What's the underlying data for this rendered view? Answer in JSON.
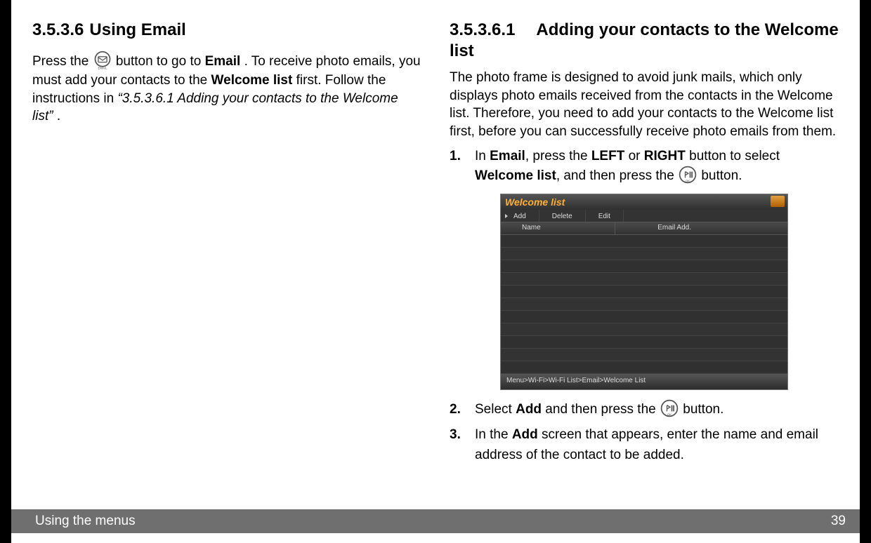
{
  "left": {
    "heading_num": "3.5.3.6",
    "heading_title": "Using Email",
    "p1_pre": "Press the ",
    "p1_mid1": " button to go to ",
    "p1_email": "Email",
    "p1_mid2": ". To receive photo emails, you must add your contacts to the ",
    "p1_welcome": "Welcome list",
    "p1_mid3": " first. Follow the instructions in ",
    "p1_ref": "“3.5.3.6.1 Adding your contacts to the Welcome list”",
    "p1_end": "."
  },
  "right": {
    "heading_num": "3.5.3.6.1",
    "heading_title": "Adding your contacts to the Welcome list",
    "intro": "The photo frame is designed to avoid junk mails, which only displays photo emails received from the contacts in the Welcome list. Therefore, you need to add your contacts to the Welcome list first, before you can successfully receive photo emails from them.",
    "steps": {
      "s1": {
        "marker": "1.",
        "t1": "In ",
        "email": "Email",
        "t2": ", press the ",
        "left": "LEFT",
        "t3": " or ",
        "right": "RIGHT",
        "t4": " button to select ",
        "wl": "Welcome list",
        "t5": ", and then press the ",
        "t6": " button."
      },
      "s2": {
        "marker": "2.",
        "t1": "Select ",
        "add": "Add",
        "t2": " and then press the ",
        "t3": " button."
      },
      "s3": {
        "marker": "3.",
        "t1": "In the ",
        "add": "Add",
        "t2": " screen that appears, enter the name and email address of the contact to be added."
      }
    }
  },
  "screenshot": {
    "title": "Welcome list",
    "tabs": [
      "Add",
      "Delete",
      "Edit"
    ],
    "columns": [
      "Name",
      "Email Add."
    ],
    "breadcrumb": "Menu>Wi-Fi>Wi-Fi List>Email>Welcome List"
  },
  "footer": {
    "section": "Using the menus",
    "page": "39"
  }
}
